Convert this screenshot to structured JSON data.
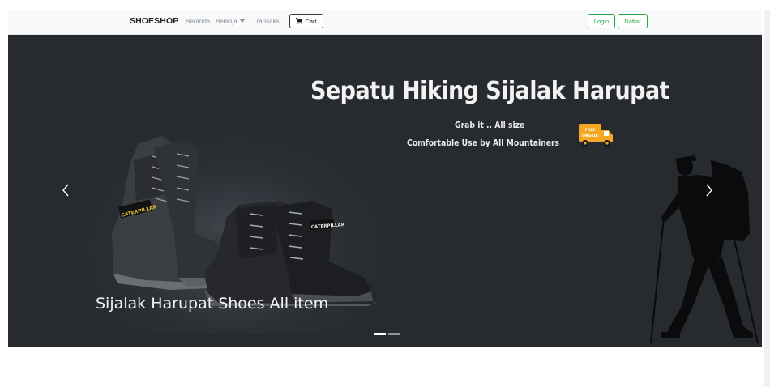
{
  "navbar": {
    "brand": "SHOESHOP",
    "links": [
      {
        "label": "Beranda"
      },
      {
        "label": "Belanja",
        "has_dropdown": true
      },
      {
        "label": "Transaksi"
      }
    ],
    "cart_label": "Cart",
    "login_label": "Login",
    "register_label": "Daftar"
  },
  "carousel": {
    "headline": "Sepatu Hiking Sijalak Harupat",
    "subline1": "Grab it .. All size",
    "subline2": "Comfortable  Use by All Mountainers",
    "badge_text_top": "FREE",
    "badge_text_bottom": "ONGKIR",
    "boot_brand_1": "CATERPILLAR",
    "boot_brand_2": "CATERPILLAR",
    "caption": "Sijalak Harupat Shoes All item",
    "prev_icon": "chevron-left-icon",
    "next_icon": "chevron-right-icon",
    "slide_count": 2,
    "active_slide": 1
  },
  "colors": {
    "navbar_bg": "#f8f9fa",
    "carousel_bg": "#272a2f",
    "accent_green": "#28a745",
    "badge_orange": "#f5a623"
  }
}
